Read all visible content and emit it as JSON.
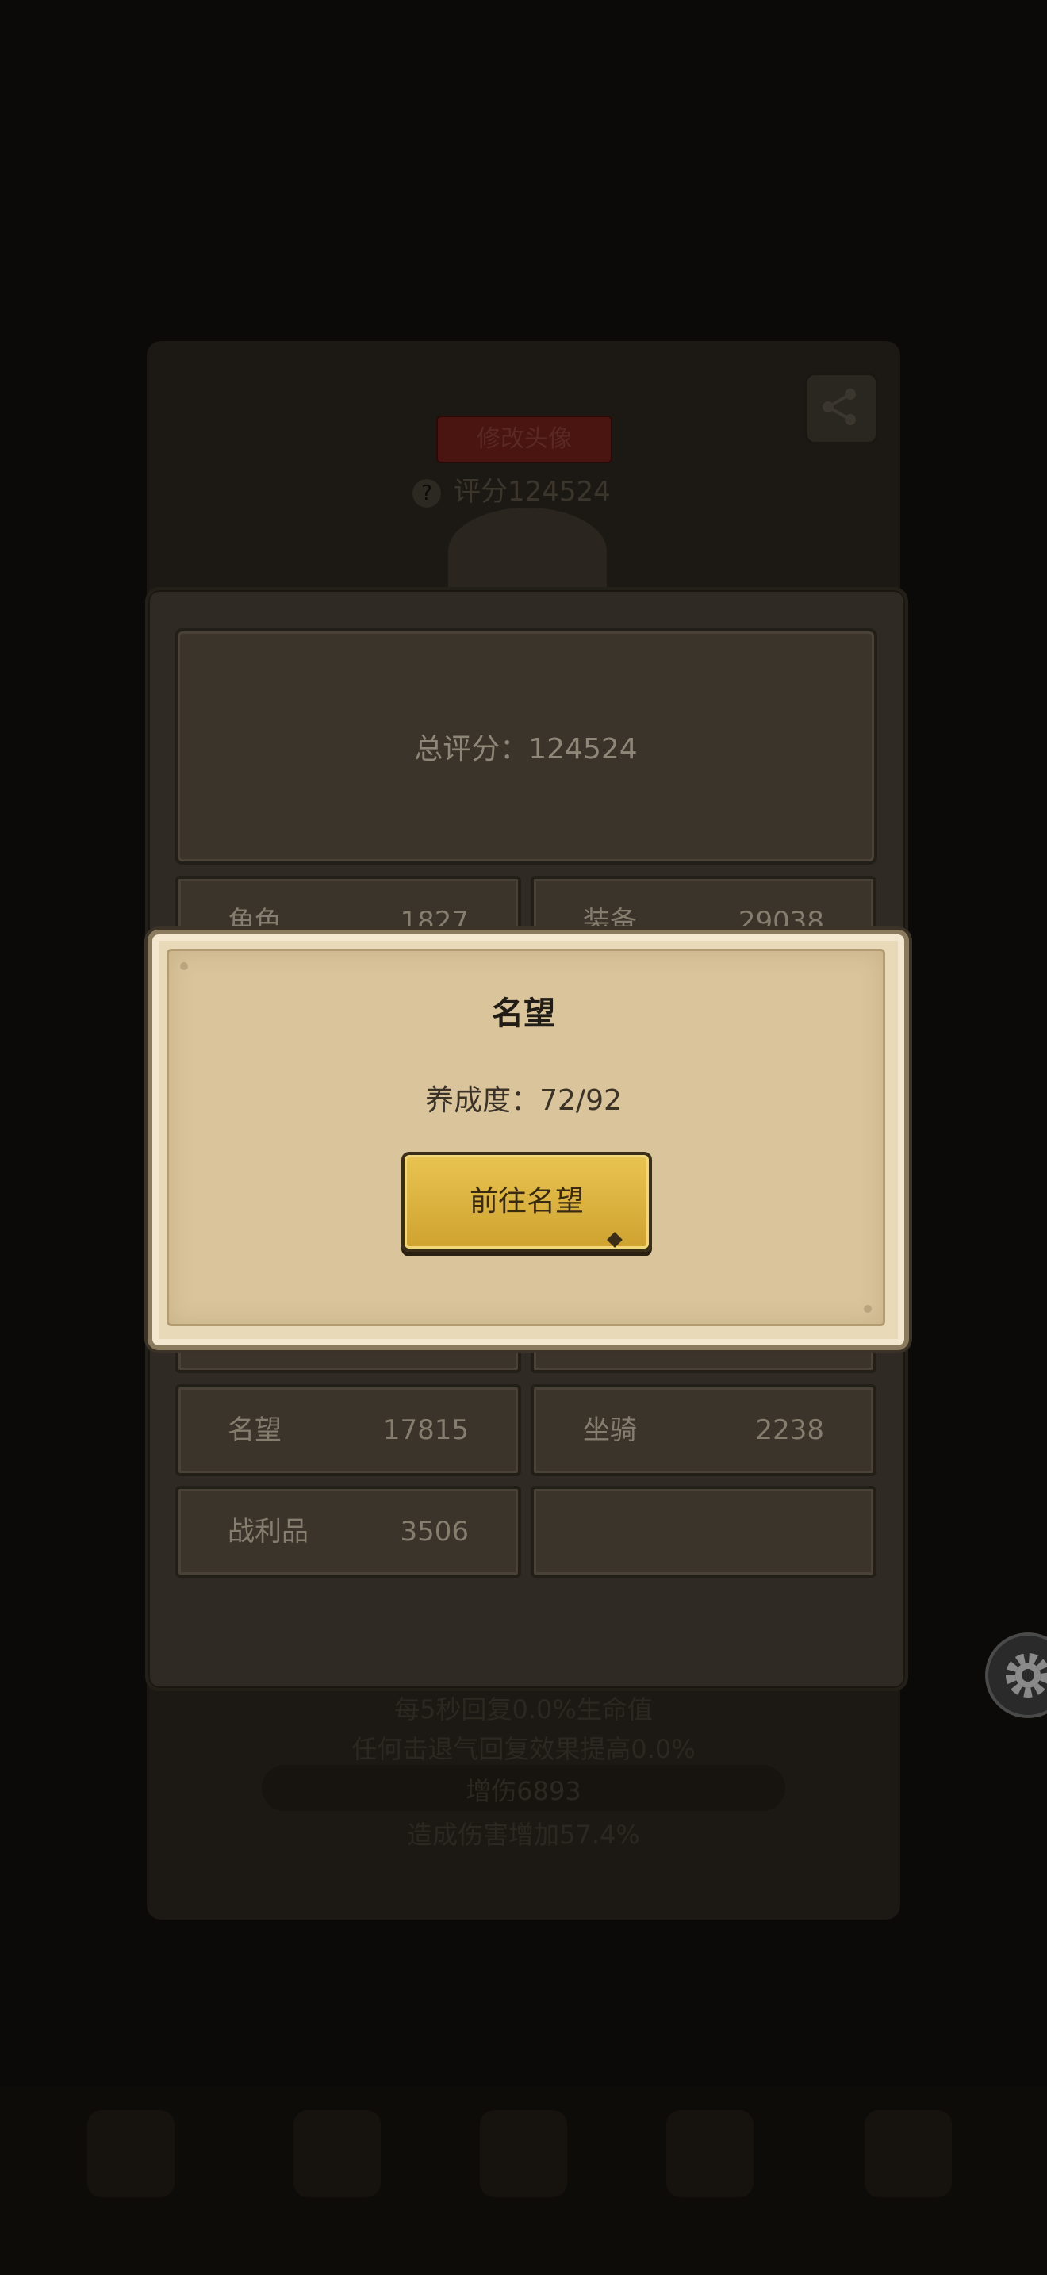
{
  "background": {
    "badge_label": "修改头像",
    "score_line": "评分124524",
    "help_icon": "?",
    "lower_lines": [
      "每5秒回复0.0%生命值",
      "任何击退气回复效果提高0.0%",
      "增伤6893",
      "造成伤害增加57.4%"
    ]
  },
  "score_panel": {
    "total_label": "总评分：124524",
    "stats": [
      {
        "label": "角色",
        "value": "1827"
      },
      {
        "label": "装备",
        "value": "29038"
      },
      {
        "label": "名望",
        "value": "17815"
      },
      {
        "label": "坐骑",
        "value": "2238"
      },
      {
        "label": "战利品",
        "value": "3506"
      },
      {
        "label": "",
        "value": ""
      }
    ]
  },
  "modal": {
    "title": "名望",
    "progress": "养成度：72/92",
    "button_label": "前往名望"
  },
  "icons": {
    "share": "share-icon",
    "settings": "gear-icon"
  },
  "colors": {
    "button_gold": "#e0b843",
    "modal_parchment": "#d9c49b",
    "panel_dark": "#2f2a23"
  }
}
